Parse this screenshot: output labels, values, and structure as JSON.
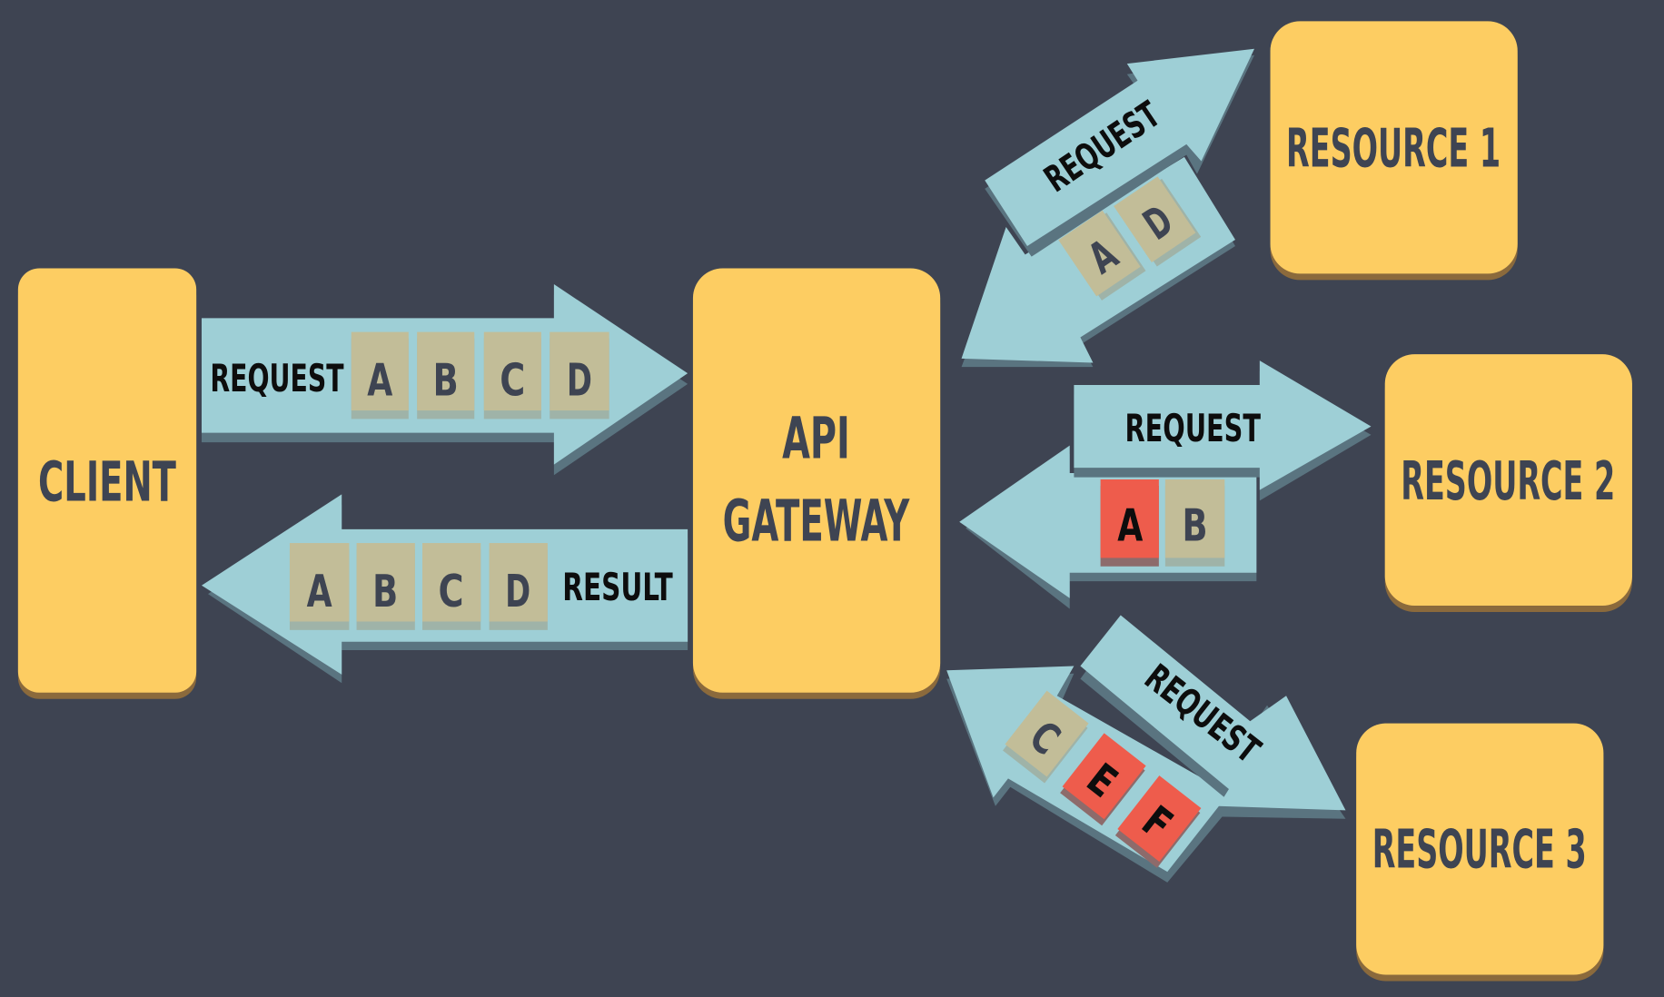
{
  "nodes": {
    "client": "CLIENT",
    "gateway_line1": "API",
    "gateway_line2": "GATEWAY",
    "resource1": "RESOURCE 1",
    "resource2": "RESOURCE 2",
    "resource3": "RESOURCE 3"
  },
  "flows": {
    "client_request": {
      "label": "REQUEST",
      "tiles": [
        "A",
        "B",
        "C",
        "D"
      ]
    },
    "client_result": {
      "label": "RESULT",
      "tiles": [
        "A",
        "B",
        "C",
        "D"
      ]
    },
    "resource1": {
      "label": "REQUEST",
      "tiles": [
        "A",
        "D"
      ]
    },
    "resource2": {
      "label": "REQUEST",
      "tiles": [
        "A",
        "B"
      ]
    },
    "resource3": {
      "label": "REQUEST",
      "tiles": [
        "C",
        "E",
        "F"
      ]
    }
  },
  "colors": {
    "background": "#3e4452",
    "node": "#fdcd62",
    "arrow": "#9ecfd6",
    "tile_neutral": "#c2bd98",
    "tile_highlight": "#ee5c4c"
  }
}
